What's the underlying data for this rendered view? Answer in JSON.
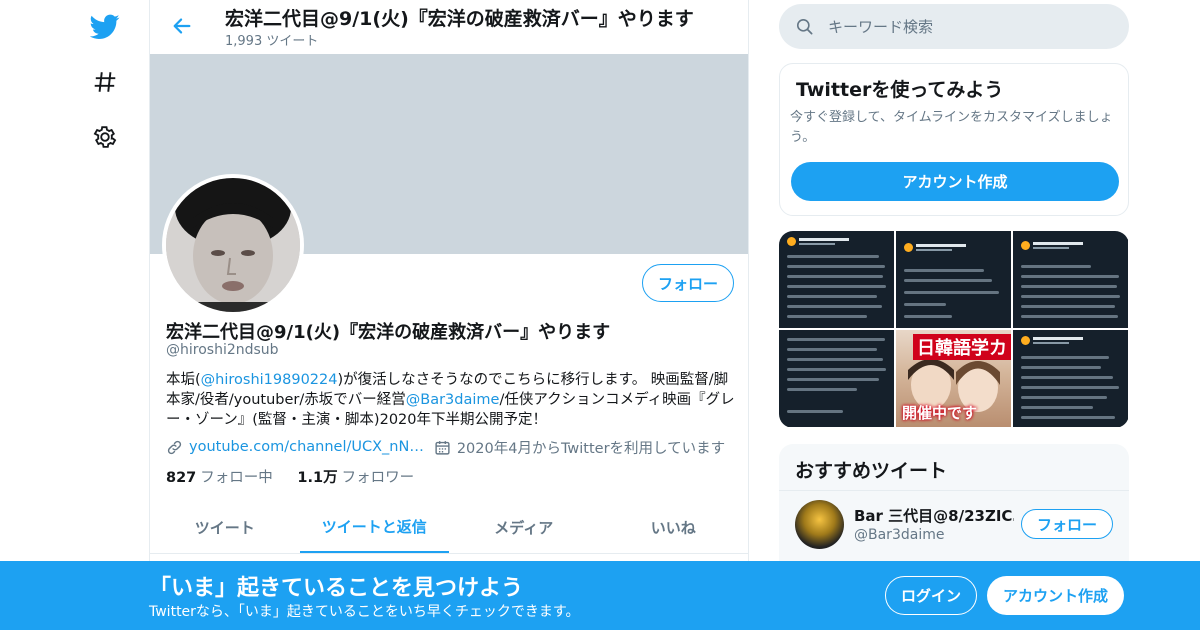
{
  "colors": {
    "accent": "#1da1f2",
    "banner": "#ccd6dd",
    "text": "#14171a",
    "secondary": "#657786",
    "link": "#1b95e0"
  },
  "nav": {
    "icons": [
      "twitter-bird-icon",
      "hashtag-icon",
      "gear-icon"
    ]
  },
  "header": {
    "title": "宏洋二代目@9/1(火)『宏洋の破産救済バー』やります",
    "tweet_count": "1,993 ツイート"
  },
  "profile": {
    "follow_label": "フォロー",
    "name": "宏洋二代目@9/1(火)『宏洋の破産救済バー』やります",
    "handle": "@hiroshi2ndsub",
    "bio": {
      "t1": "本垢(",
      "link1": "@hiroshi19890224",
      "t2": ")が復活しなさそうなのでこちらに移行します。 映画監督/脚本家/役者/youtuber/赤坂でバー経営",
      "link2": "@Bar3daime",
      "t3": "/任侠アクションコメディ映画『グレー・ゾーン』(監督・主演・脚本)2020年下半期公開予定！"
    },
    "website": "youtube.com/channel/UCX_nN…",
    "joined": "2020年4月からTwitterを利用しています",
    "following_count": "827",
    "following_label": "フォロー中",
    "followers_count": "1.1万",
    "followers_label": "フォロワー"
  },
  "tabs": [
    {
      "label": "ツイート",
      "active": false
    },
    {
      "label": "ツイートと返信",
      "active": true
    },
    {
      "label": "メディア",
      "active": false
    },
    {
      "label": "いいね",
      "active": false
    }
  ],
  "search": {
    "placeholder": "キーワード検索"
  },
  "signup_card": {
    "title": "Twitterを使ってみよう",
    "text": "今すぐ登録して、タイムラインをカスタマイズしましょう。",
    "button": "アカウント作成"
  },
  "media_grid": {
    "overlay_top": "日韓語学カ",
    "overlay_bottom": "開催中です"
  },
  "recommended": {
    "title": "おすすめツイート",
    "items": [
      {
        "name": "Bar 三代目@8/23ZIC…",
        "handle": "@Bar3daime",
        "follow_label": "フォロー"
      }
    ]
  },
  "bottom_bar": {
    "title": "「いま」起きていることを見つけよう",
    "subtitle": "Twitterなら、「いま」起きていることをいち早くチェックできます。",
    "login": "ログイン",
    "signup": "アカウント作成"
  }
}
